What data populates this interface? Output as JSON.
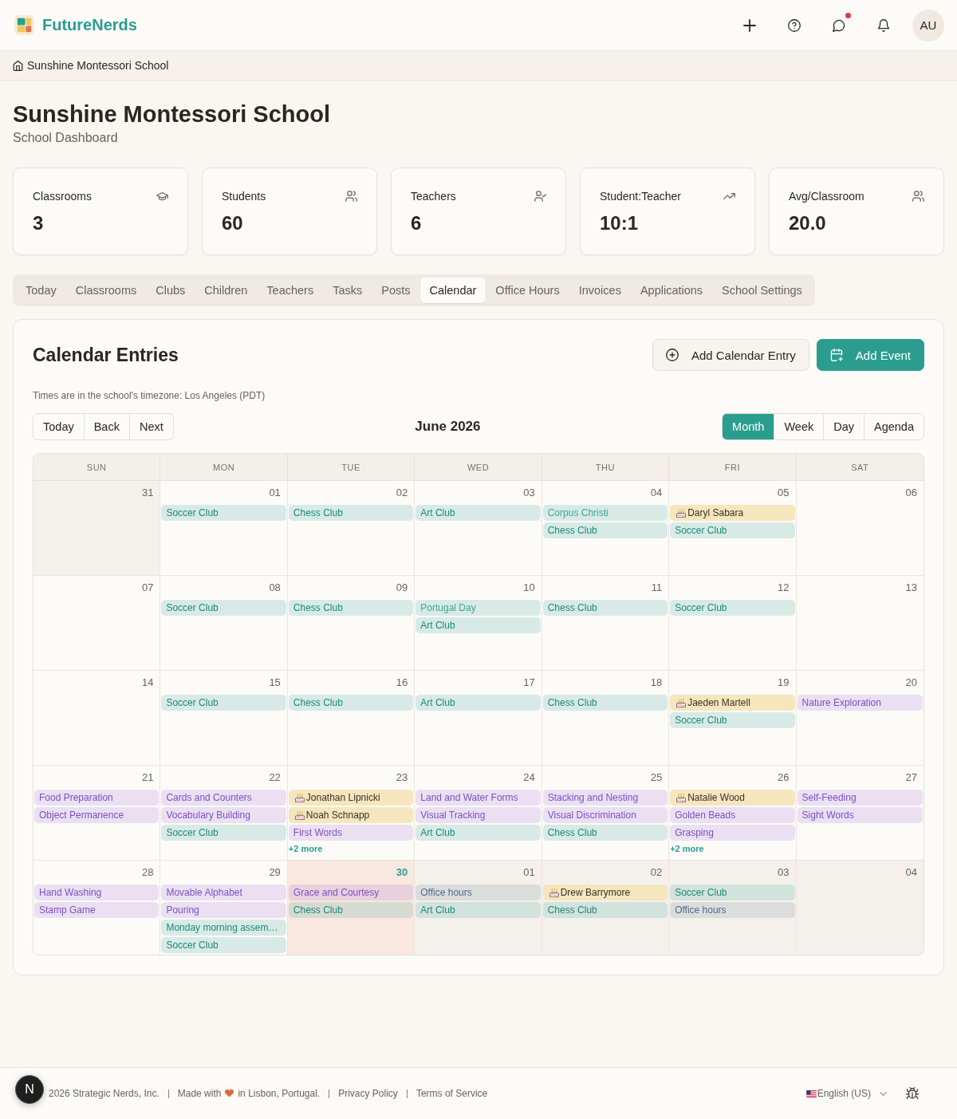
{
  "header": {
    "brand": "FutureNerds",
    "messages_unread": true,
    "avatar": "AU"
  },
  "breadcrumb": {
    "label": "Sunshine Montessori School"
  },
  "page": {
    "title": "Sunshine Montessori School",
    "subtitle": "School Dashboard"
  },
  "stats": [
    {
      "label": "Classrooms",
      "value": "3"
    },
    {
      "label": "Students",
      "value": "60"
    },
    {
      "label": "Teachers",
      "value": "6"
    },
    {
      "label": "Student:Teacher",
      "value": "10:1"
    },
    {
      "label": "Avg/Classroom",
      "value": "20.0"
    }
  ],
  "tabs": [
    {
      "label": "Today",
      "selected": false
    },
    {
      "label": "Classrooms",
      "selected": false
    },
    {
      "label": "Clubs",
      "selected": false
    },
    {
      "label": "Children",
      "selected": false
    },
    {
      "label": "Teachers",
      "selected": false
    },
    {
      "label": "Tasks",
      "selected": false
    },
    {
      "label": "Posts",
      "selected": false
    },
    {
      "label": "Calendar",
      "selected": true
    },
    {
      "label": "Office Hours",
      "selected": false
    },
    {
      "label": "Invoices",
      "selected": false
    },
    {
      "label": "Applications",
      "selected": false
    },
    {
      "label": "School Settings",
      "selected": false
    }
  ],
  "calendar": {
    "title": "Calendar Entries",
    "actions": [
      {
        "label": "Add Calendar Entry",
        "kind": "outline"
      },
      {
        "label": "Add Event",
        "kind": "primary"
      }
    ],
    "timezone_note": "Times are in the school's timezone: Los Angeles (PDT)",
    "nav": [
      "Today",
      "Back",
      "Next"
    ],
    "period": "June 2026",
    "views": [
      {
        "label": "Month",
        "selected": true
      },
      {
        "label": "Week",
        "selected": false
      },
      {
        "label": "Day",
        "selected": false
      },
      {
        "label": "Agenda",
        "selected": false
      }
    ],
    "weekdays": [
      "SUN",
      "MON",
      "TUE",
      "WED",
      "THU",
      "FRI",
      "SAT"
    ],
    "weeks": [
      [
        {
          "date": "31",
          "outside": true,
          "today": false
        },
        {
          "date": "01",
          "outside": false,
          "today": false,
          "events": [
            {
              "label": "Soccer Club",
              "kind": "club"
            }
          ]
        },
        {
          "date": "02",
          "outside": false,
          "today": false,
          "events": [
            {
              "label": "Chess Club",
              "kind": "club"
            }
          ]
        },
        {
          "date": "03",
          "outside": false,
          "today": false,
          "events": [
            {
              "label": "Art Club",
              "kind": "club"
            }
          ]
        },
        {
          "date": "04",
          "outside": false,
          "today": false,
          "events": [
            {
              "label": "Corpus Christi",
              "kind": "holiday"
            },
            {
              "label": "Chess Club",
              "kind": "club"
            }
          ]
        },
        {
          "date": "05",
          "outside": false,
          "today": false,
          "events": [
            {
              "label": "Daryl Sabara",
              "kind": "birthday"
            },
            {
              "label": "Soccer Club",
              "kind": "club"
            }
          ]
        },
        {
          "date": "06",
          "outside": false,
          "today": false
        }
      ],
      [
        {
          "date": "07",
          "outside": false,
          "today": false
        },
        {
          "date": "08",
          "outside": false,
          "today": false,
          "events": [
            {
              "label": "Soccer Club",
              "kind": "club"
            }
          ]
        },
        {
          "date": "09",
          "outside": false,
          "today": false,
          "events": [
            {
              "label": "Chess Club",
              "kind": "club"
            }
          ]
        },
        {
          "date": "10",
          "outside": false,
          "today": false,
          "events": [
            {
              "label": "Portugal Day",
              "kind": "holiday"
            },
            {
              "label": "Art Club",
              "kind": "club"
            }
          ]
        },
        {
          "date": "11",
          "outside": false,
          "today": false,
          "events": [
            {
              "label": "Chess Club",
              "kind": "club"
            }
          ]
        },
        {
          "date": "12",
          "outside": false,
          "today": false,
          "events": [
            {
              "label": "Soccer Club",
              "kind": "club"
            }
          ]
        },
        {
          "date": "13",
          "outside": false,
          "today": false
        }
      ],
      [
        {
          "date": "14",
          "outside": false,
          "today": false
        },
        {
          "date": "15",
          "outside": false,
          "today": false,
          "events": [
            {
              "label": "Soccer Club",
              "kind": "club"
            }
          ]
        },
        {
          "date": "16",
          "outside": false,
          "today": false,
          "events": [
            {
              "label": "Chess Club",
              "kind": "club"
            }
          ]
        },
        {
          "date": "17",
          "outside": false,
          "today": false,
          "events": [
            {
              "label": "Art Club",
              "kind": "club"
            }
          ]
        },
        {
          "date": "18",
          "outside": false,
          "today": false,
          "events": [
            {
              "label": "Chess Club",
              "kind": "club"
            }
          ]
        },
        {
          "date": "19",
          "outside": false,
          "today": false,
          "events": [
            {
              "label": "Jaeden Martell",
              "kind": "birthday"
            },
            {
              "label": "Soccer Club",
              "kind": "club"
            }
          ]
        },
        {
          "date": "20",
          "outside": false,
          "today": false,
          "events": [
            {
              "label": "Nature Exploration",
              "kind": "lesson"
            }
          ]
        }
      ],
      [
        {
          "date": "21",
          "outside": false,
          "today": false,
          "events": [
            {
              "label": "Food Preparation",
              "kind": "lesson"
            },
            {
              "label": "Object Permanence",
              "kind": "lesson"
            }
          ]
        },
        {
          "date": "22",
          "outside": false,
          "today": false,
          "events": [
            {
              "label": "Cards and Counters",
              "kind": "lesson"
            },
            {
              "label": "Vocabulary Building",
              "kind": "lesson"
            },
            {
              "label": "Soccer Club",
              "kind": "club"
            }
          ]
        },
        {
          "date": "23",
          "outside": false,
          "today": false,
          "events": [
            {
              "label": "Jonathan Lipnicki",
              "kind": "birthday"
            },
            {
              "label": "Noah Schnapp",
              "kind": "birthday"
            },
            {
              "label": "First Words",
              "kind": "lesson"
            }
          ],
          "more": "+2 more"
        },
        {
          "date": "24",
          "outside": false,
          "today": false,
          "events": [
            {
              "label": "Land and Water Forms",
              "kind": "lesson"
            },
            {
              "label": "Visual Tracking",
              "kind": "lesson"
            },
            {
              "label": "Art Club",
              "kind": "club"
            }
          ]
        },
        {
          "date": "25",
          "outside": false,
          "today": false,
          "events": [
            {
              "label": "Stacking and Nesting",
              "kind": "lesson"
            },
            {
              "label": "Visual Discrimination",
              "kind": "lesson"
            },
            {
              "label": "Chess Club",
              "kind": "club"
            }
          ]
        },
        {
          "date": "26",
          "outside": false,
          "today": false,
          "events": [
            {
              "label": "Natalie Wood",
              "kind": "birthday"
            },
            {
              "label": "Golden Beads",
              "kind": "lesson"
            },
            {
              "label": "Grasping",
              "kind": "lesson"
            }
          ],
          "more": "+2 more"
        },
        {
          "date": "27",
          "outside": false,
          "today": false,
          "events": [
            {
              "label": "Self-Feeding",
              "kind": "lesson"
            },
            {
              "label": "Sight Words",
              "kind": "lesson"
            }
          ]
        }
      ],
      [
        {
          "date": "28",
          "outside": false,
          "today": false,
          "events": [
            {
              "label": "Hand Washing",
              "kind": "lesson"
            },
            {
              "label": "Stamp Game",
              "kind": "lesson"
            }
          ]
        },
        {
          "date": "29",
          "outside": false,
          "today": false,
          "events": [
            {
              "label": "Movable Alphabet",
              "kind": "lesson"
            },
            {
              "label": "Pouring",
              "kind": "lesson"
            },
            {
              "label": "Monday morning assem…",
              "kind": "club"
            },
            {
              "label": "Soccer Club",
              "kind": "club"
            }
          ]
        },
        {
          "date": "30",
          "outside": false,
          "today": true,
          "events": [
            {
              "label": "Grace and Courtesy",
              "kind": "lesson"
            },
            {
              "label": "Chess Club",
              "kind": "club"
            }
          ]
        },
        {
          "date": "01",
          "outside": true,
          "today": false,
          "events": [
            {
              "label": "Office hours",
              "kind": "office"
            },
            {
              "label": "Art Club",
              "kind": "club"
            }
          ]
        },
        {
          "date": "02",
          "outside": true,
          "today": false,
          "events": [
            {
              "label": "Drew Barrymore",
              "kind": "birthday"
            },
            {
              "label": "Chess Club",
              "kind": "club"
            }
          ]
        },
        {
          "date": "03",
          "outside": true,
          "today": false,
          "events": [
            {
              "label": "Soccer Club",
              "kind": "club"
            },
            {
              "label": "Office hours",
              "kind": "office"
            }
          ]
        },
        {
          "date": "04",
          "outside": true,
          "today": false
        }
      ]
    ]
  },
  "footer": {
    "copyright": "2026 Strategic Nerds, Inc.",
    "made_with": "Made with",
    "made_in": "in Lisbon, Portugal.",
    "links": [
      "Privacy Policy",
      "Terms of Service"
    ],
    "language": "English (US)"
  },
  "dev_badge": "N"
}
